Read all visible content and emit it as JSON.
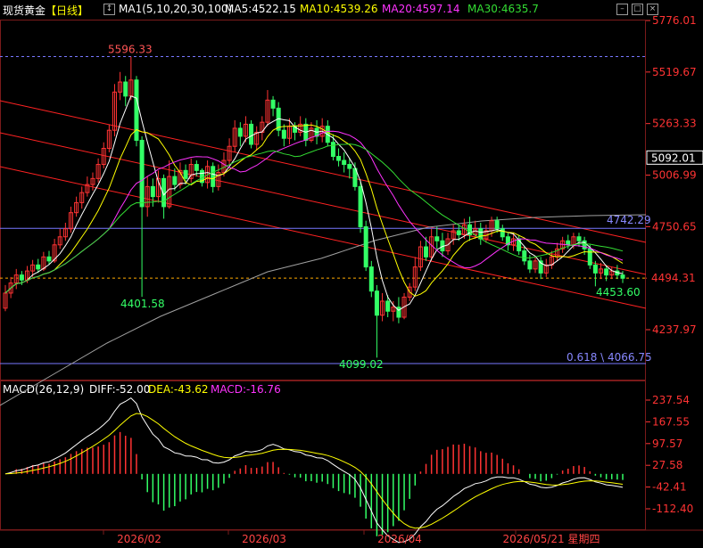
{
  "header": {
    "symbol": "现货黄金",
    "period": "【日线】",
    "ma_setting": "MA1(5,10,20,30,100)",
    "ma5": "MA5:4522.15",
    "ma10": "MA10:4539.26",
    "ma20": "MA20:4597.14",
    "ma30": "MA30:4635.7"
  },
  "macd_header": {
    "setting": "MACD(26,12,9)",
    "diff": "DIFF:-52.00",
    "dea": "DEA:-43.62",
    "macd": "MACD:-16.76"
  },
  "colors": {
    "up": "#ff3333",
    "down": "#33ff66",
    "ma5": "#ffffff",
    "ma10": "#ffff00",
    "ma20": "#ff33ff",
    "ma30": "#33dd33",
    "ma100": "#a0a0a0",
    "axis": "#ff3333"
  },
  "annotations": {
    "high": "5596.33",
    "low1": "4401.58",
    "low2": "4099.02",
    "recent_low": "4453.60",
    "h_line": "4742.29",
    "fib": "0.618 \\ 4066.75",
    "last_price": "5092.01",
    "current_ref": "4494.31"
  },
  "chart_data": {
    "type": "candlestick",
    "price_axis_ticks": [
      "5776.01",
      "5519.67",
      "5263.33",
      "5006.99",
      "4750.65",
      "4494.31",
      "4237.97"
    ],
    "macd_axis_ticks": [
      "237.54",
      "167.55",
      "97.57",
      "27.58",
      "-42.41",
      "-112.40"
    ],
    "x_labels": [
      "2026/02",
      "2026/03",
      "2026/04",
      "2026/05/21 星期四"
    ],
    "candles": [
      [
        4345,
        4420,
        4330,
        4460
      ],
      [
        4420,
        4470,
        4395,
        4500
      ],
      [
        4470,
        4510,
        4440,
        4540
      ],
      [
        4510,
        4485,
        4460,
        4530
      ],
      [
        4485,
        4530,
        4470,
        4555
      ],
      [
        4530,
        4560,
        4500,
        4585
      ],
      [
        4560,
        4540,
        4520,
        4590
      ],
      [
        4540,
        4600,
        4530,
        4625
      ],
      [
        4600,
        4580,
        4560,
        4630
      ],
      [
        4580,
        4660,
        4570,
        4690
      ],
      [
        4660,
        4700,
        4640,
        4740
      ],
      [
        4700,
        4740,
        4680,
        4770
      ],
      [
        4740,
        4820,
        4720,
        4850
      ],
      [
        4820,
        4870,
        4800,
        4900
      ],
      [
        4870,
        4920,
        4840,
        4950
      ],
      [
        4920,
        4960,
        4900,
        5000
      ],
      [
        4960,
        4990,
        4930,
        5020
      ],
      [
        4990,
        5060,
        4970,
        5090
      ],
      [
        5060,
        5140,
        5040,
        5170
      ],
      [
        5140,
        5230,
        5120,
        5260
      ],
      [
        5230,
        5420,
        5200,
        5460
      ],
      [
        5420,
        5470,
        5380,
        5520
      ],
      [
        5470,
        5400,
        5350,
        5500
      ],
      [
        5400,
        5480,
        5380,
        5596
      ],
      [
        5480,
        5180,
        5150,
        5500
      ],
      [
        5180,
        4850,
        4401.58,
        5200
      ],
      [
        4850,
        4950,
        4800,
        5000
      ],
      [
        4950,
        4900,
        4850,
        4990
      ],
      [
        4900,
        4990,
        4870,
        5030
      ],
      [
        4990,
        4850,
        4790,
        5010
      ],
      [
        4850,
        5000,
        4840,
        5080
      ],
      [
        5000,
        4960,
        4930,
        5040
      ],
      [
        4960,
        5030,
        4940,
        5070
      ],
      [
        5030,
        4990,
        4960,
        5060
      ],
      [
        4990,
        5060,
        4970,
        5090
      ],
      [
        5060,
        5030,
        5000,
        5080
      ],
      [
        5030,
        4970,
        4950,
        5040
      ],
      [
        4970,
        5050,
        4940,
        5080
      ],
      [
        5050,
        4950,
        4920,
        5070
      ],
      [
        4950,
        5020,
        4930,
        5060
      ],
      [
        5020,
        5080,
        5000,
        5120
      ],
      [
        5080,
        5150,
        5060,
        5190
      ],
      [
        5150,
        5240,
        5120,
        5280
      ],
      [
        5240,
        5200,
        5150,
        5270
      ],
      [
        5200,
        5260,
        5170,
        5300
      ],
      [
        5260,
        5160,
        5140,
        5280
      ],
      [
        5160,
        5220,
        5130,
        5250
      ],
      [
        5220,
        5270,
        5180,
        5300
      ],
      [
        5270,
        5380,
        5250,
        5430
      ],
      [
        5380,
        5340,
        5300,
        5400
      ],
      [
        5340,
        5230,
        5200,
        5370
      ],
      [
        5230,
        5190,
        5150,
        5260
      ],
      [
        5190,
        5250,
        5160,
        5290
      ],
      [
        5250,
        5220,
        5180,
        5270
      ],
      [
        5220,
        5260,
        5200,
        5300
      ],
      [
        5260,
        5180,
        5150,
        5290
      ],
      [
        5180,
        5240,
        5170,
        5270
      ],
      [
        5240,
        5200,
        5160,
        5280
      ],
      [
        5200,
        5250,
        5170,
        5290
      ],
      [
        5250,
        5170,
        5150,
        5280
      ],
      [
        5170,
        5100,
        5080,
        5210
      ],
      [
        5100,
        5080,
        5050,
        5140
      ],
      [
        5080,
        5060,
        5020,
        5120
      ],
      [
        5060,
        5040,
        4990,
        5090
      ],
      [
        5040,
        4950,
        4930,
        5070
      ],
      [
        4950,
        4750,
        4720,
        4980
      ],
      [
        4750,
        4550,
        4530,
        4780
      ],
      [
        4550,
        4430,
        4400,
        4580
      ],
      [
        4430,
        4310,
        4099.02,
        4460
      ],
      [
        4310,
        4380,
        4280,
        4420
      ],
      [
        4380,
        4330,
        4300,
        4410
      ],
      [
        4330,
        4350,
        4280,
        4380
      ],
      [
        4350,
        4300,
        4270,
        4400
      ],
      [
        4300,
        4400,
        4290,
        4420
      ],
      [
        4400,
        4450,
        4380,
        4470
      ],
      [
        4450,
        4550,
        4430,
        4600
      ],
      [
        4550,
        4650,
        4530,
        4680
      ],
      [
        4650,
        4600,
        4580,
        4700
      ],
      [
        4600,
        4700,
        4580,
        4740
      ],
      [
        4700,
        4680,
        4640,
        4750
      ],
      [
        4680,
        4630,
        4600,
        4720
      ],
      [
        4630,
        4690,
        4610,
        4720
      ],
      [
        4690,
        4730,
        4660,
        4760
      ],
      [
        4730,
        4710,
        4680,
        4760
      ],
      [
        4710,
        4760,
        4690,
        4790
      ],
      [
        4760,
        4710,
        4680,
        4800
      ],
      [
        4710,
        4740,
        4690,
        4780
      ],
      [
        4740,
        4690,
        4660,
        4770
      ],
      [
        4690,
        4730,
        4670,
        4760
      ],
      [
        4730,
        4780,
        4700,
        4800
      ],
      [
        4780,
        4740,
        4720,
        4800
      ],
      [
        4740,
        4700,
        4680,
        4760
      ],
      [
        4700,
        4660,
        4630,
        4720
      ],
      [
        4660,
        4690,
        4630,
        4720
      ],
      [
        4690,
        4630,
        4610,
        4710
      ],
      [
        4630,
        4580,
        4560,
        4650
      ],
      [
        4580,
        4540,
        4520,
        4610
      ],
      [
        4540,
        4580,
        4520,
        4600
      ],
      [
        4580,
        4520,
        4490,
        4600
      ],
      [
        4520,
        4560,
        4500,
        4590
      ],
      [
        4560,
        4600,
        4540,
        4630
      ],
      [
        4600,
        4640,
        4580,
        4670
      ],
      [
        4640,
        4680,
        4620,
        4700
      ],
      [
        4680,
        4660,
        4640,
        4710
      ],
      [
        4660,
        4700,
        4640,
        4720
      ],
      [
        4700,
        4680,
        4650,
        4720
      ],
      [
        4680,
        4640,
        4610,
        4700
      ],
      [
        4640,
        4560,
        4540,
        4660
      ],
      [
        4560,
        4520,
        4453.6,
        4580
      ],
      [
        4520,
        4540,
        4490,
        4570
      ],
      [
        4540,
        4510,
        4480,
        4560
      ],
      [
        4510,
        4530,
        4490,
        4550
      ],
      [
        4530,
        4510,
        4490,
        4560
      ],
      [
        4510,
        4494,
        4470,
        4530
      ]
    ],
    "ma_series": [
      {
        "name": "MA5"
      },
      {
        "name": "MA10"
      },
      {
        "name": "MA20"
      },
      {
        "name": "MA30"
      }
    ]
  }
}
